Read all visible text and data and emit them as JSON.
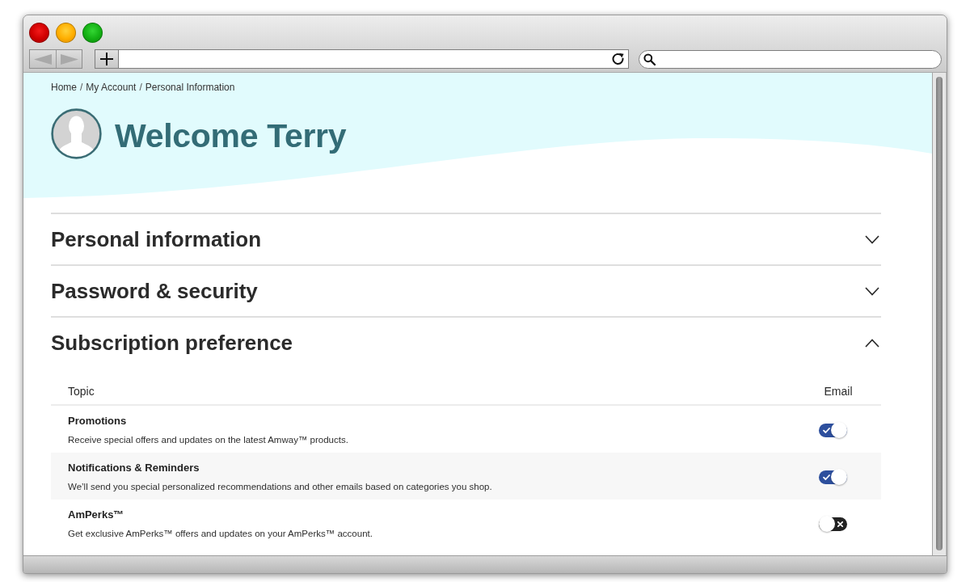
{
  "breadcrumb": {
    "items": [
      {
        "label": "Home"
      },
      {
        "separator": "/",
        "label": "My Account"
      },
      {
        "separator": "/",
        "label": "Personal Information"
      }
    ]
  },
  "greeting": "Welcome Terry",
  "sections": [
    {
      "title": "Personal information",
      "expanded": false
    },
    {
      "title": "Password & security",
      "expanded": false
    },
    {
      "title": "Subscription preference",
      "expanded": true,
      "table": {
        "columns": [
          "Topic",
          "Email"
        ],
        "rows": [
          {
            "title": "Promotions",
            "description": "Receive special offers and updates on the latest Amway™ products.",
            "email_on": true
          },
          {
            "title": "Notifications & Reminders",
            "description": "We’ll send you special personalized recommendations and other emails based on categories you shop.",
            "email_on": true
          },
          {
            "title": "AmPerks™",
            "description": "Get exclusive AmPerks™ offers and updates on your AmPerks™ account.",
            "email_on": false
          }
        ]
      }
    }
  ]
}
